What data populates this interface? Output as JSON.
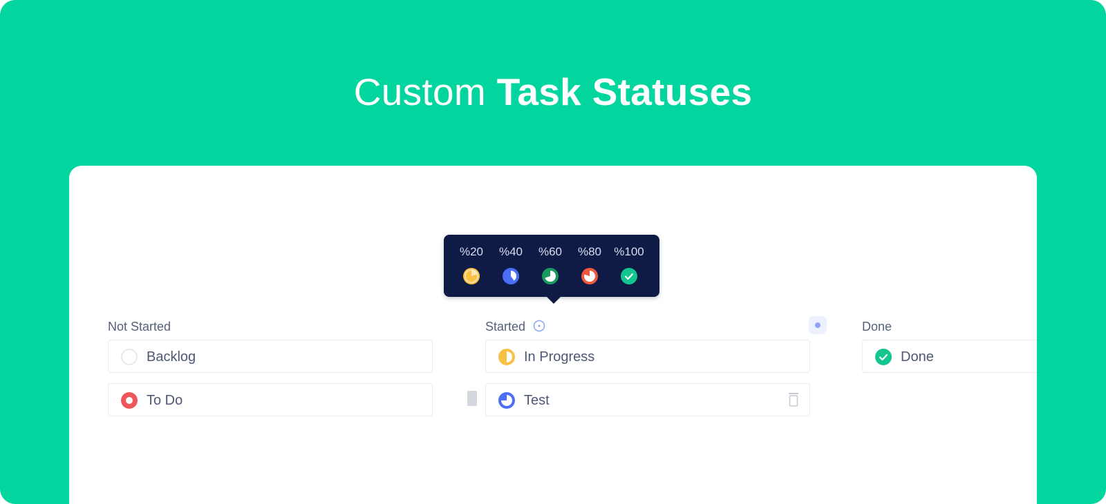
{
  "hero": {
    "title_light": "Custom",
    "title_bold": "Task Statuses"
  },
  "tooltip": {
    "items": [
      {
        "label": "%20",
        "color": "#f7c143",
        "icon": "progress-20-icon"
      },
      {
        "label": "%40",
        "color": "#4a6ef5",
        "icon": "progress-40-icon"
      },
      {
        "label": "%60",
        "color": "#1a9b5c",
        "icon": "progress-60-icon"
      },
      {
        "label": "%80",
        "color": "#f0573f",
        "icon": "progress-80-icon"
      },
      {
        "label": "%100",
        "color": "#13c58e",
        "icon": "check-circle-icon"
      }
    ]
  },
  "columns": {
    "not_started": {
      "title": "Not Started",
      "statuses": [
        {
          "label": "Backlog",
          "icon": "empty-circle-icon"
        },
        {
          "label": "To Do",
          "icon": "todo-ring-icon",
          "color": "#f0575a"
        }
      ]
    },
    "started": {
      "title": "Started",
      "statuses": [
        {
          "label": "In Progress",
          "icon": "half-circle-icon",
          "color": "#f7c143"
        },
        {
          "label": "Test",
          "icon": "quarter-circle-icon",
          "color": "#4a6ef5"
        }
      ]
    },
    "done": {
      "title": "Done",
      "statuses": [
        {
          "label": "Done",
          "icon": "check-circle-icon",
          "color": "#13c58e"
        }
      ]
    }
  },
  "colors": {
    "brand_green": "#03d59f",
    "tooltip_bg": "#0f1a45"
  }
}
